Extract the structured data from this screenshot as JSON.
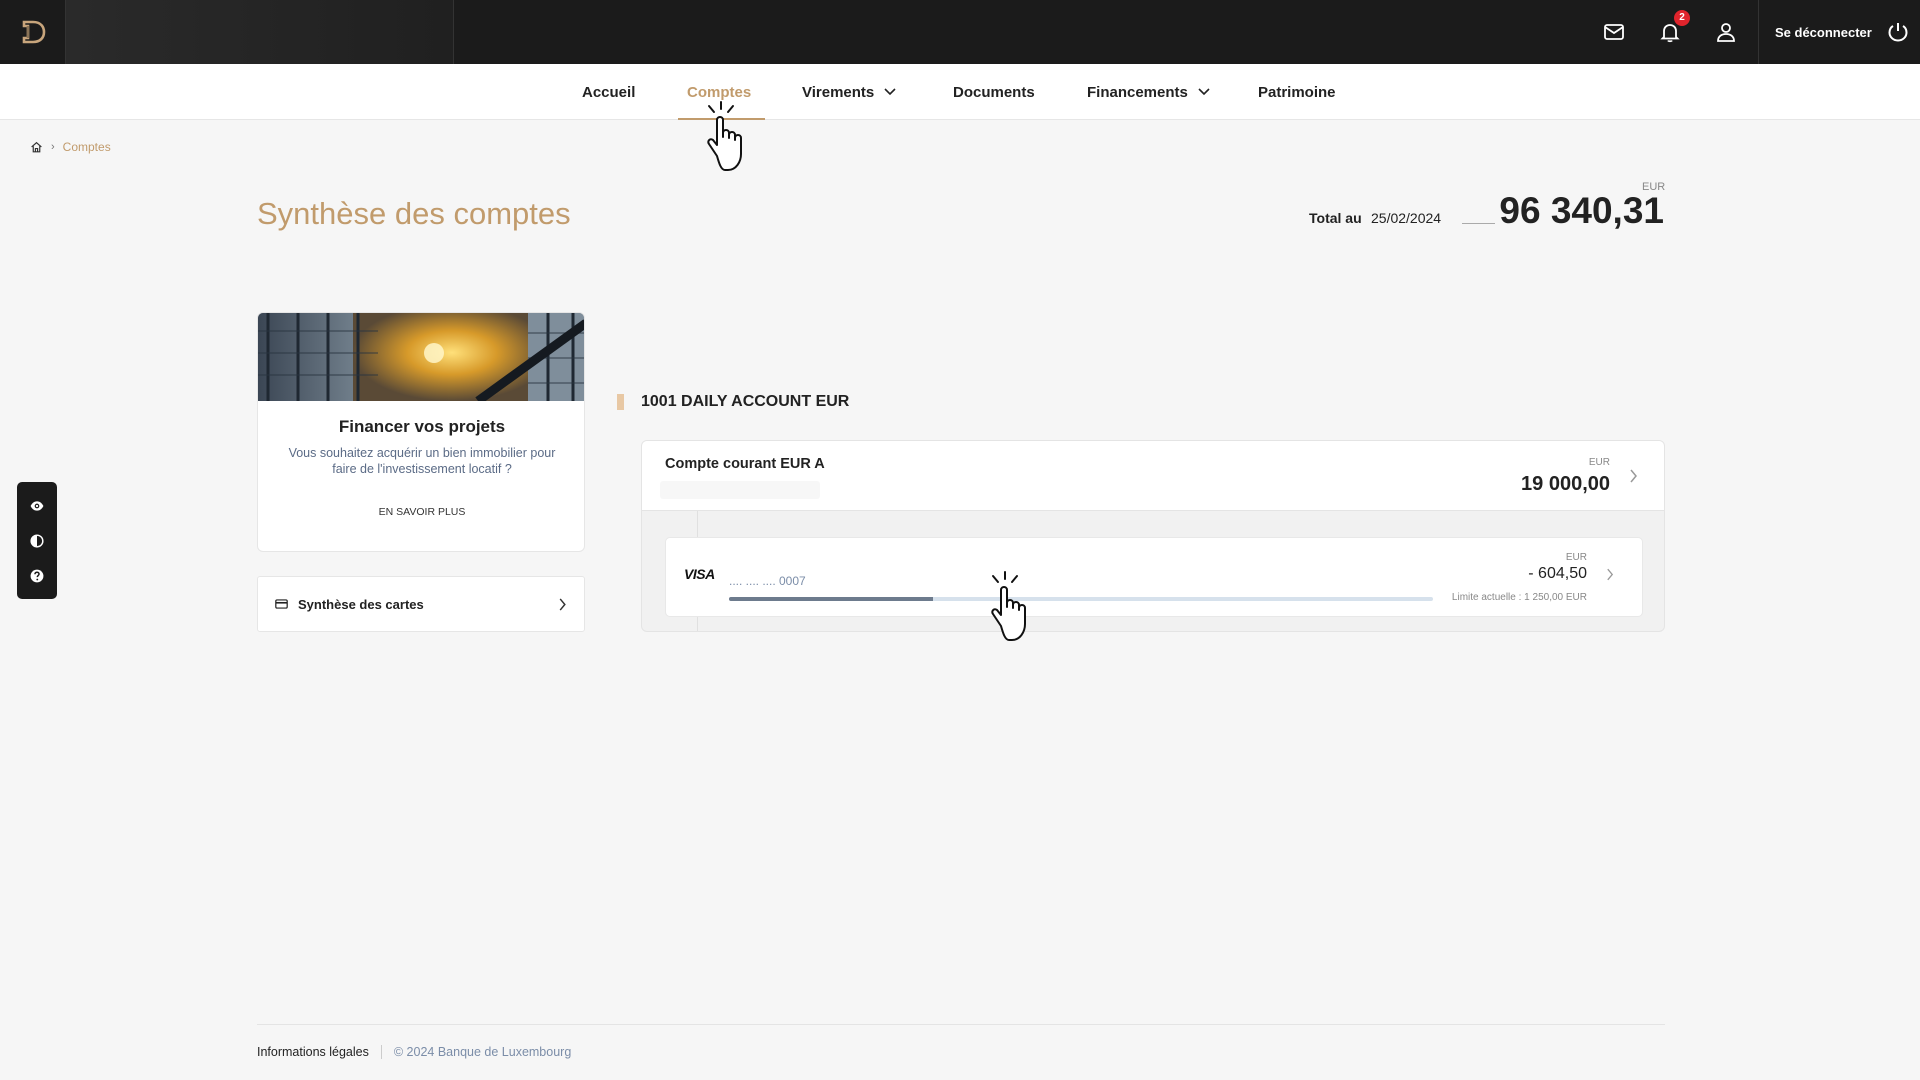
{
  "topbar": {
    "notifications_count": "2",
    "logout_label": "Se déconnecter"
  },
  "nav": {
    "items": [
      {
        "label": "Accueil"
      },
      {
        "label": "Comptes"
      },
      {
        "label": "Virements"
      },
      {
        "label": "Documents"
      },
      {
        "label": "Financements"
      },
      {
        "label": "Patrimoine"
      }
    ],
    "active": "Comptes"
  },
  "breadcrumb": {
    "current": "Comptes"
  },
  "summary": {
    "title": "Synthèse des comptes",
    "total_label": "Total au",
    "total_date": "25/02/2024",
    "currency": "EUR",
    "total_amount": "96 340,31"
  },
  "promo": {
    "title": "Financer vos projets",
    "text": "Vous souhaitez acquérir un bien immobilier pour faire de l'investissement locatif ?",
    "link_label": "EN SAVOIR PLUS"
  },
  "cards_summary": {
    "label": "Synthèse des cartes"
  },
  "account_group": {
    "title": "1001 DAILY ACCOUNT EUR",
    "account": {
      "name": "Compte courant EUR A",
      "currency": "EUR",
      "amount": "19 000,00"
    },
    "card": {
      "brand": "VISA",
      "number": ".... .... .... 0007",
      "currency": "EUR",
      "amount": "- 604,50",
      "limit": "Limite actuelle : 1 250,00 EUR",
      "usage_fraction": 0.29
    }
  },
  "footer": {
    "legal": "Informations légales",
    "copyright": "© 2024 Banque de Luxembourg"
  },
  "colors": {
    "accent": "#c19b6c",
    "dark": "#1b1b1b",
    "badge": "#e0242c",
    "muted_blue": "#7b8da8"
  }
}
